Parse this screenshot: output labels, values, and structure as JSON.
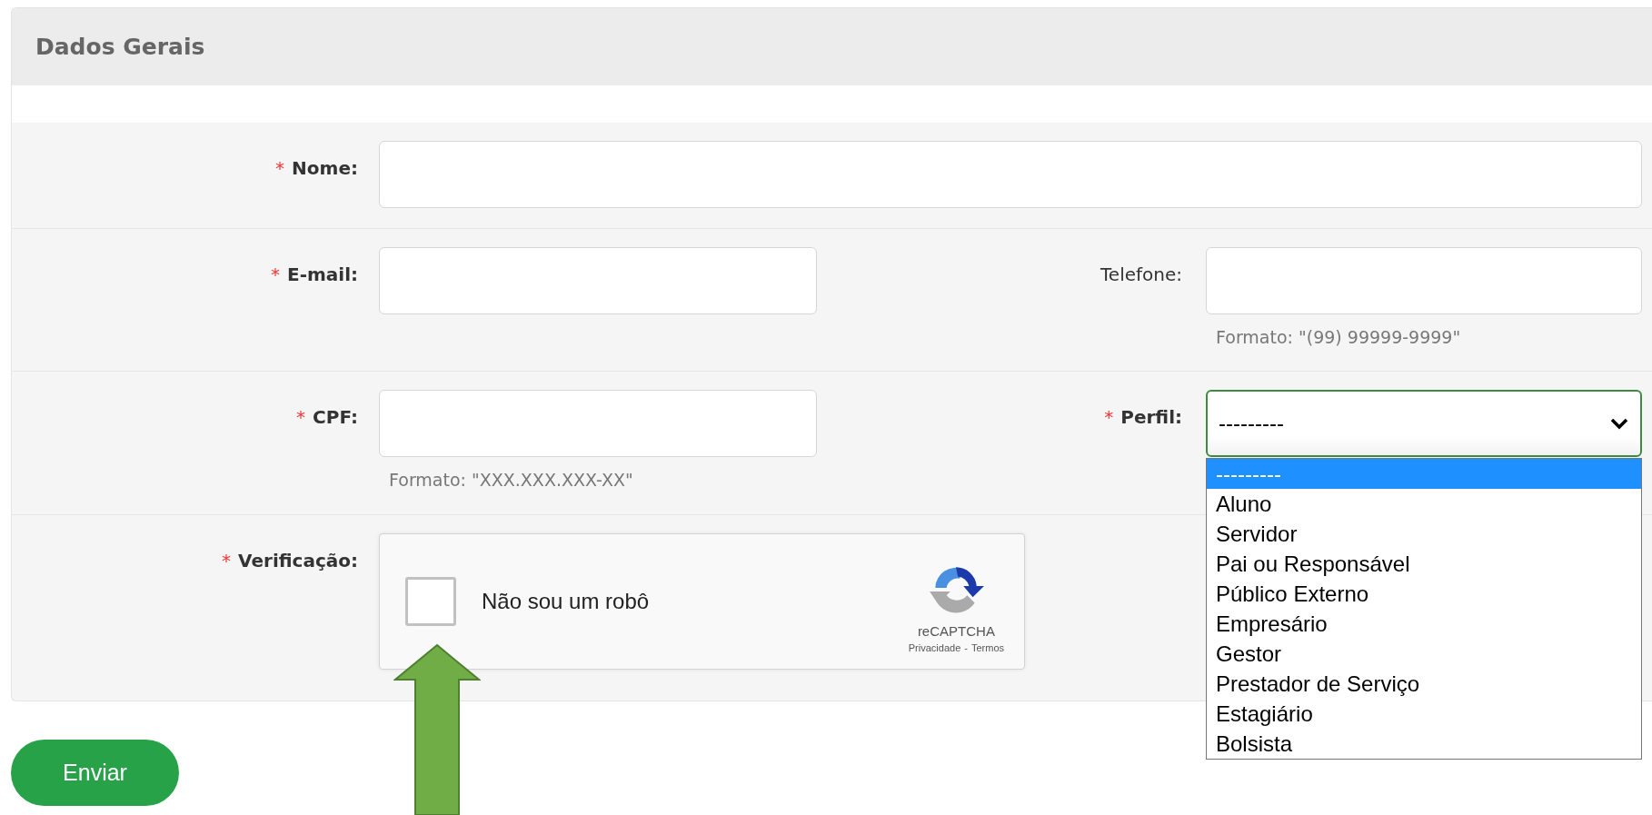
{
  "panel": {
    "title": "Dados Gerais"
  },
  "rows": [
    {
      "fields": [
        {
          "kind": "text",
          "marker": "*",
          "label": "Nome:"
        }
      ]
    },
    {
      "fields": [
        {
          "kind": "text",
          "marker": "*",
          "label": "E-mail:"
        },
        {
          "kind": "text",
          "label": "Telefone:",
          "hint": "Formato: \"(99) 99999-9999\""
        }
      ]
    },
    {
      "fields": [
        {
          "kind": "text",
          "marker": "*",
          "label": "CPF:",
          "hint": "Formato: \"XXX.XXX.XXX-XX\""
        },
        {
          "kind": "select",
          "marker": "*",
          "label": "Perfil:",
          "value": "---------",
          "focused": true,
          "expanded": true,
          "options": [
            {
              "label": "---------",
              "selected": true
            },
            {
              "label": "Aluno",
              "selected": false
            },
            {
              "label": "Servidor",
              "selected": false
            },
            {
              "label": "Pai ou Responsável",
              "selected": false
            },
            {
              "label": "Público Externo",
              "selected": false
            },
            {
              "label": "Empresário",
              "selected": false
            },
            {
              "label": "Gestor",
              "selected": false
            },
            {
              "label": "Prestador de Serviço",
              "selected": false
            },
            {
              "label": "Estagiário",
              "selected": false
            },
            {
              "label": "Bolsista",
              "selected": false
            }
          ]
        }
      ]
    },
    {
      "fields": [
        {
          "kind": "captcha",
          "marker": "*",
          "label": "Verificação:",
          "text": "Não sou um robô",
          "checked": false,
          "brand": "reCAPTCHA",
          "links": [
            "Privacidade",
            "Termos"
          ],
          "separator": "-"
        }
      ]
    }
  ],
  "submit": {
    "label": "Enviar"
  }
}
